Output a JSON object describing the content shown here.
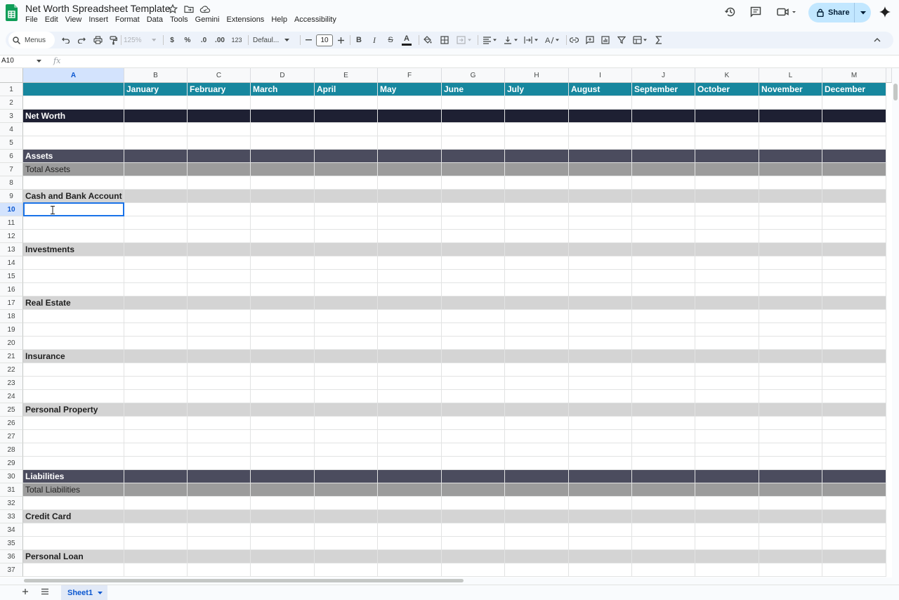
{
  "app": {
    "doc_title": "Net Worth Spreadsheet Template",
    "menus": [
      "File",
      "Edit",
      "View",
      "Insert",
      "Format",
      "Data",
      "Tools",
      "Gemini",
      "Extensions",
      "Help",
      "Accessibility"
    ],
    "share_label": "Share",
    "accent_color": "#c2e7ff"
  },
  "toolbar": {
    "menus_label": "Menus",
    "zoom": "125%",
    "currency": "$",
    "percent": "%",
    "dec_decrease": ".0",
    "dec_increase": ".00",
    "number_format": "123",
    "font": "Defaul...",
    "font_size": "10",
    "bold": "B",
    "italic": "I",
    "strike": "S",
    "text_color": "A"
  },
  "formula_bar": {
    "name_box": "A10",
    "fx": "fx",
    "content": ""
  },
  "sheet": {
    "columns": [
      "A",
      "B",
      "C",
      "D",
      "E",
      "F",
      "G",
      "H",
      "I",
      "J",
      "K",
      "L",
      "M"
    ],
    "selected_column": "A",
    "selected_row": "10",
    "months": [
      "January",
      "February",
      "March",
      "April",
      "May",
      "June",
      "July",
      "August",
      "September",
      "October",
      "November",
      "December"
    ],
    "rows": [
      {
        "n": "1",
        "label": "",
        "style": "month"
      },
      {
        "n": "2",
        "label": "",
        "style": ""
      },
      {
        "n": "3",
        "label": "Net Worth",
        "style": "networth"
      },
      {
        "n": "4",
        "label": "",
        "style": ""
      },
      {
        "n": "5",
        "label": "",
        "style": ""
      },
      {
        "n": "6",
        "label": "Assets",
        "style": "assets"
      },
      {
        "n": "7",
        "label": "Total Assets",
        "style": "total"
      },
      {
        "n": "8",
        "label": "",
        "style": ""
      },
      {
        "n": "9",
        "label": "Cash and Bank Account",
        "style": "section"
      },
      {
        "n": "10",
        "label": "",
        "style": ""
      },
      {
        "n": "11",
        "label": "",
        "style": ""
      },
      {
        "n": "12",
        "label": "",
        "style": ""
      },
      {
        "n": "13",
        "label": "Investments",
        "style": "section"
      },
      {
        "n": "14",
        "label": "",
        "style": ""
      },
      {
        "n": "15",
        "label": "",
        "style": ""
      },
      {
        "n": "16",
        "label": "",
        "style": ""
      },
      {
        "n": "17",
        "label": "Real Estate",
        "style": "section"
      },
      {
        "n": "18",
        "label": "",
        "style": ""
      },
      {
        "n": "19",
        "label": "",
        "style": ""
      },
      {
        "n": "20",
        "label": "",
        "style": ""
      },
      {
        "n": "21",
        "label": "Insurance",
        "style": "section"
      },
      {
        "n": "22",
        "label": "",
        "style": ""
      },
      {
        "n": "23",
        "label": "",
        "style": ""
      },
      {
        "n": "24",
        "label": "",
        "style": ""
      },
      {
        "n": "25",
        "label": "Personal Property",
        "style": "section"
      },
      {
        "n": "26",
        "label": "",
        "style": ""
      },
      {
        "n": "27",
        "label": "",
        "style": ""
      },
      {
        "n": "28",
        "label": "",
        "style": ""
      },
      {
        "n": "29",
        "label": "",
        "style": ""
      },
      {
        "n": "30",
        "label": "Liabilities",
        "style": "assets"
      },
      {
        "n": "31",
        "label": "Total Liabilities",
        "style": "total"
      },
      {
        "n": "32",
        "label": "",
        "style": ""
      },
      {
        "n": "33",
        "label": "Credit Card",
        "style": "section"
      },
      {
        "n": "34",
        "label": "",
        "style": ""
      },
      {
        "n": "35",
        "label": "",
        "style": ""
      },
      {
        "n": "36",
        "label": "Personal Loan",
        "style": "section"
      },
      {
        "n": "37",
        "label": "",
        "style": ""
      }
    ],
    "tab_name": "Sheet1"
  }
}
